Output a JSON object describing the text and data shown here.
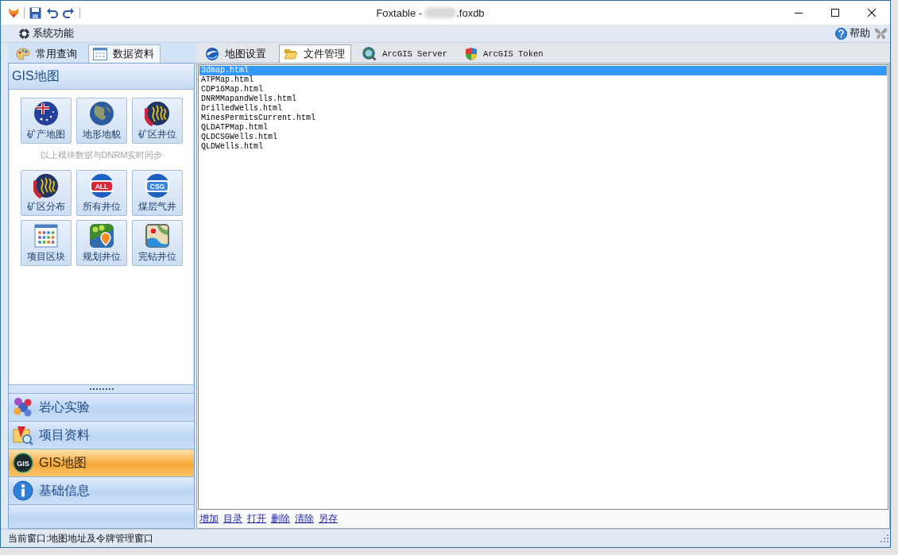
{
  "window": {
    "title_start": "Foxtable -",
    "redacted": true,
    "title_end": ".foxdb"
  },
  "menu_bar": {
    "items": [
      {
        "label": "系统功能"
      }
    ],
    "help": "帮助"
  },
  "left_tabs": [
    {
      "label": "常用查询",
      "kind": "palette",
      "selected": false
    },
    {
      "label": "数据资料",
      "kind": "calendar",
      "selected": true
    }
  ],
  "left_panel": {
    "header": "GIS地图",
    "synced_tiles": [
      {
        "label": "矿产地图",
        "kind": "flag"
      },
      {
        "label": "地形地貌",
        "kind": "earth"
      },
      {
        "label": "矿区井位",
        "kind": "stripes"
      }
    ],
    "sync_note": "以上模块数据与DNRM实时同步",
    "tiles": [
      {
        "label": "矿区分布",
        "kind": "stripes"
      },
      {
        "label": "所有井位",
        "kind": "redbanner",
        "icon_text": "ALL"
      },
      {
        "label": "煤层气井",
        "kind": "bluebanner",
        "icon_text": "CSG"
      },
      {
        "label": "项目区块",
        "kind": "grid"
      },
      {
        "label": "规划井位",
        "kind": "pin"
      },
      {
        "label": "完钻井位",
        "kind": "map"
      }
    ],
    "nav": [
      {
        "label": "岩心实验",
        "kind": "molecule",
        "selected": false
      },
      {
        "label": "项目资料",
        "kind": "document",
        "selected": false
      },
      {
        "label": "GIS地图",
        "kind": "gis",
        "icon_text": "GIS",
        "selected": true
      },
      {
        "label": "基础信息",
        "kind": "info",
        "selected": false
      }
    ]
  },
  "right_tabs": [
    {
      "label": "地图设置",
      "kind": "earth",
      "selected": false
    },
    {
      "label": "文件管理",
      "kind": "folder",
      "selected": true
    },
    {
      "label": "ArcGIS Server",
      "kind": "server",
      "selected": false
    },
    {
      "label": "ArcGIS Token",
      "kind": "shield",
      "selected": false
    }
  ],
  "files": [
    {
      "name": "3dmap.html",
      "selected": true
    },
    {
      "name": "ATPMap.html",
      "selected": false
    },
    {
      "name": "CDP16Map.html",
      "selected": false
    },
    {
      "name": "DNRMMapandWells.html",
      "selected": false
    },
    {
      "name": "DrilledWells.html",
      "selected": false
    },
    {
      "name": "MinesPermitsCurrent.html",
      "selected": false
    },
    {
      "name": "QLDATPMap.html",
      "selected": false
    },
    {
      "name": "QLDCSGWells.html",
      "selected": false
    },
    {
      "name": "QLDWells.html",
      "selected": false
    }
  ],
  "file_actions": [
    "增加",
    "目录",
    "打开",
    "删除",
    "清除",
    "另存"
  ],
  "status_bar": "当前窗口:地图地址及令牌管理窗口"
}
